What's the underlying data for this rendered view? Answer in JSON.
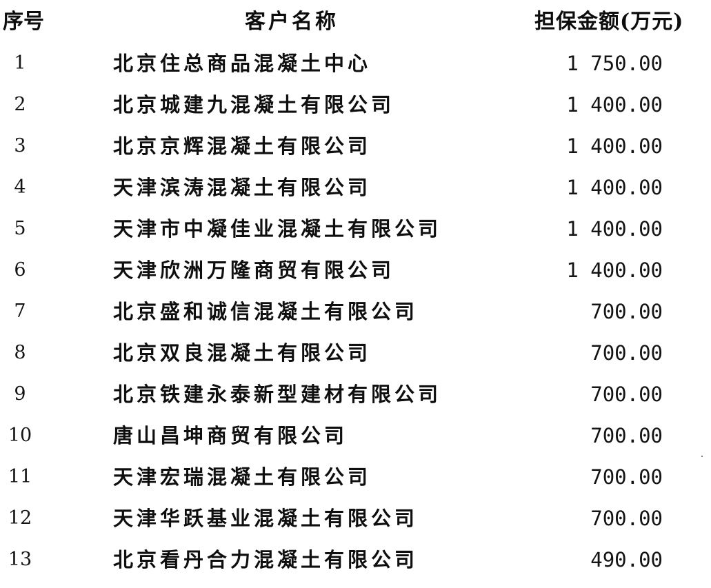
{
  "header": {
    "no_label": "序号",
    "name_label": "客户名称",
    "amount_label": "担保金额(万元)"
  },
  "rows": [
    {
      "no": "1",
      "name": "北京住总商品混凝土中心",
      "amount": "1 750.00"
    },
    {
      "no": "2",
      "name": "北京城建九混凝土有限公司",
      "amount": "1 400.00"
    },
    {
      "no": "3",
      "name": "北京京辉混凝土有限公司",
      "amount": "1 400.00"
    },
    {
      "no": "4",
      "name": "天津滨涛混凝土有限公司",
      "amount": "1 400.00"
    },
    {
      "no": "5",
      "name": "天津市中凝佳业混凝土有限公司",
      "amount": "1 400.00"
    },
    {
      "no": "6",
      "name": "天津欣洲万隆商贸有限公司",
      "amount": "1 400.00"
    },
    {
      "no": "7",
      "name": "北京盛和诚信混凝土有限公司",
      "amount": "700.00"
    },
    {
      "no": "8",
      "name": "北京双良混凝土有限公司",
      "amount": "700.00"
    },
    {
      "no": "9",
      "name": "北京铁建永泰新型建材有限公司",
      "amount": "700.00"
    },
    {
      "no": "10",
      "name": "唐山昌坤商贸有限公司",
      "amount": "700.00"
    },
    {
      "no": "11",
      "name": "天津宏瑞混凝土有限公司",
      "amount": "700.00"
    },
    {
      "no": "12",
      "name": "天津华跃基业混凝土有限公司",
      "amount": "700.00"
    },
    {
      "no": "13",
      "name": "北京看丹合力混凝土有限公司",
      "amount": "490.00"
    }
  ]
}
